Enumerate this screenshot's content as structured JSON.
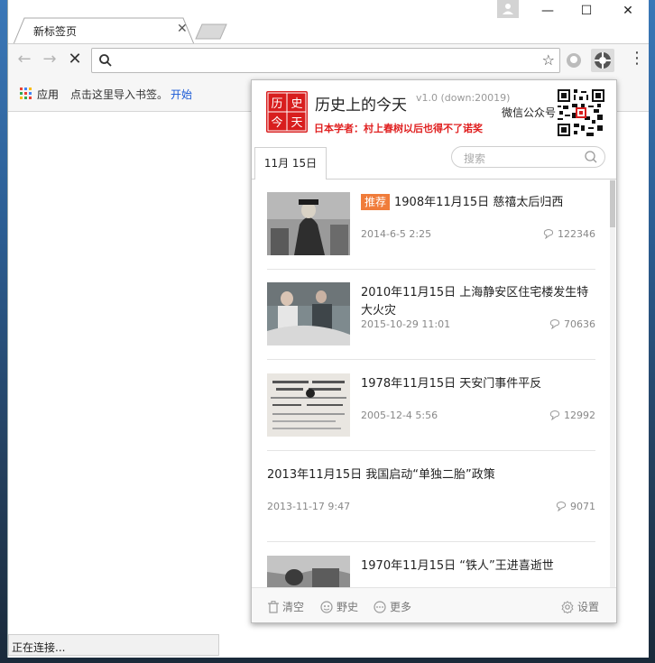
{
  "browser": {
    "tab_title": "新标签页",
    "bookmarks": {
      "apps_label": "应用",
      "hint": "点击这里导入书签。",
      "start_link": "开始"
    },
    "status_text": "正在连接..."
  },
  "popup": {
    "title": "历史上的今天",
    "version": "v1.0  (down:20019)",
    "subtitle": "日本学者：村上春树以后也得不了诺奖",
    "logo_chars": [
      "历",
      "史",
      "今",
      "天"
    ],
    "wechat_label": "微信公众号",
    "date_tab": "11月 15日",
    "search_placeholder": "搜索",
    "items": [
      {
        "badge": "推荐",
        "title": "1908年11月15日 慈禧太后归西",
        "date": "2014-6-5 2:25",
        "count": "122346"
      },
      {
        "title": "2010年11月15日 上海静安区住宅楼发生特大火灾",
        "date": "2015-10-29 11:01",
        "count": "70636"
      },
      {
        "title": "1978年11月15日 天安门事件平反",
        "date": "2005-12-4 5:56",
        "count": "12992"
      },
      {
        "title": "2013年11月15日 我国启动“单独二胎”政策",
        "date": "2013-11-17 9:47",
        "count": "9071"
      },
      {
        "title": "1970年11月15日 “铁人”王进喜逝世",
        "date": "",
        "count": ""
      }
    ],
    "footer": {
      "clear": "清空",
      "wild_history": "野史",
      "more": "更多",
      "settings": "设置"
    }
  },
  "colors": {
    "badge": "#f07c3a",
    "subtitle": "#e02020",
    "logo_red": "#d81e1e",
    "link": "#1a5ad6"
  }
}
